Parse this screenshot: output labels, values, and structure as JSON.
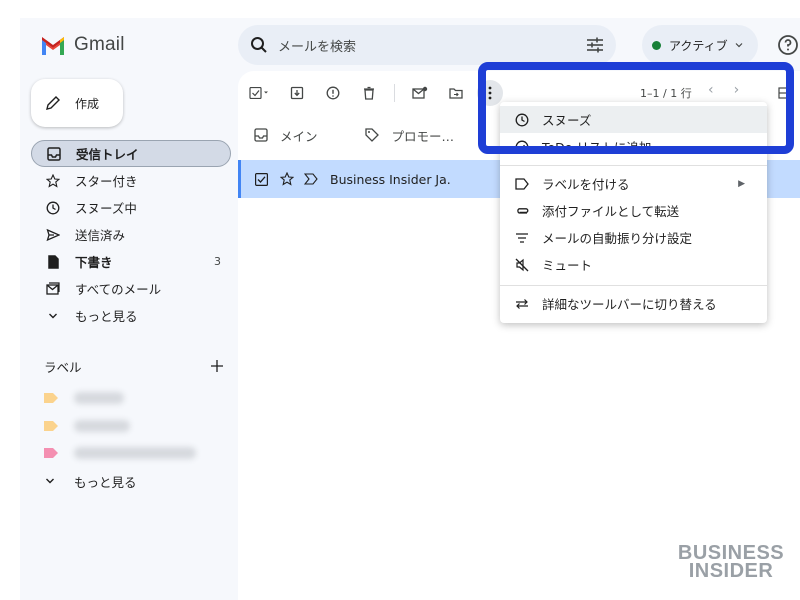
{
  "app": {
    "name": "Gmail",
    "search_placeholder": "メールを検索",
    "status": "アクティブ",
    "status_color": "#188038"
  },
  "compose": {
    "label": "作成"
  },
  "nav": {
    "items": [
      {
        "label": "受信トレイ",
        "icon": "inbox-icon",
        "selected": true
      },
      {
        "label": "スター付き",
        "icon": "star-icon"
      },
      {
        "label": "スヌーズ中",
        "icon": "clock-icon"
      },
      {
        "label": "送信済み",
        "icon": "send-icon"
      },
      {
        "label": "下書き",
        "icon": "draft-icon",
        "count": "3"
      },
      {
        "label": "すべてのメール",
        "icon": "all-mail-icon"
      },
      {
        "label": "もっと見る",
        "icon": "chevron-down-icon"
      }
    ]
  },
  "labels": {
    "heading": "ラベル",
    "more": "もっと見る",
    "items": [
      {
        "color": "#fbd38d"
      },
      {
        "color": "#fbd38d"
      },
      {
        "color": "#f48fb1"
      }
    ]
  },
  "toolbar": {
    "pager": "1–1 / 1 行"
  },
  "tabs": [
    {
      "label": "メイン",
      "icon": "inbox-icon"
    },
    {
      "label": "プロモー…",
      "icon": "tag-icon"
    }
  ],
  "email": {
    "sender": "Business Insider Ja."
  },
  "menu": {
    "items": [
      {
        "label": "スヌーズ",
        "icon": "clock-icon"
      },
      {
        "label": "ToDo リストに追加",
        "icon": "add-task-icon"
      },
      {
        "label": "ラベルを付ける",
        "icon": "label-icon"
      },
      {
        "label": "添付ファイルとして転送",
        "icon": "attachment-icon"
      },
      {
        "label": "メールの自動振り分け設定",
        "icon": "filter-icon"
      },
      {
        "label": "ミュート",
        "icon": "mute-icon"
      },
      {
        "label": "詳細なツールバーに切り替える",
        "icon": "swap-icon"
      }
    ]
  },
  "watermark": {
    "line1": "BUSINESS",
    "line2": "INSIDER"
  },
  "accent": "#1e3ed6"
}
